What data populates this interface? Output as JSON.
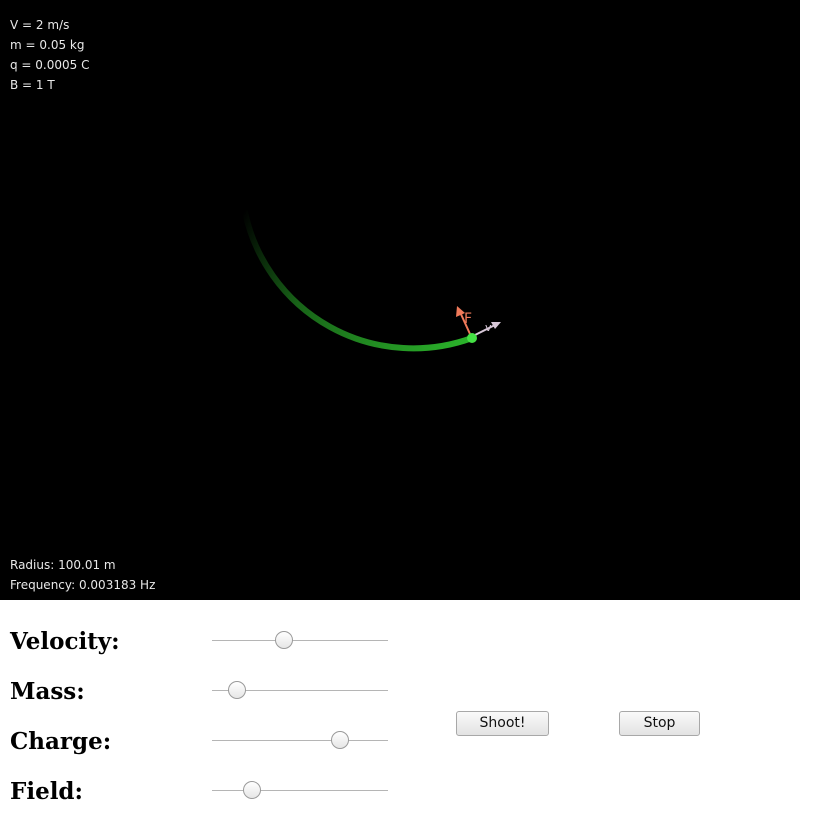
{
  "simulation": {
    "params": {
      "velocity": "V = 2 m/s",
      "mass": "m = 0.05 kg",
      "charge": "q = 0.0005 C",
      "field": "B = 1 T"
    },
    "results": {
      "radius": "Radius: 100.01 m",
      "frequency": "Frequency: 0.003183 Hz"
    },
    "force_label": "F",
    "velocity_label": "v",
    "colors": {
      "background": "#000000",
      "trail": "#2bb32b",
      "particle": "#44e044",
      "force_arrow": "#f07a5a",
      "velocity_arrow": "#d8c8d8"
    }
  },
  "controls": {
    "velocity": {
      "label": "Velocity:",
      "level": 0.41
    },
    "mass": {
      "label": "Mass:",
      "level": 0.14
    },
    "charge": {
      "label": "Charge:",
      "level": 0.73
    },
    "field": {
      "label": "Field:",
      "level": 0.23
    },
    "shoot_label": "Shoot!",
    "stop_label": "Stop"
  }
}
